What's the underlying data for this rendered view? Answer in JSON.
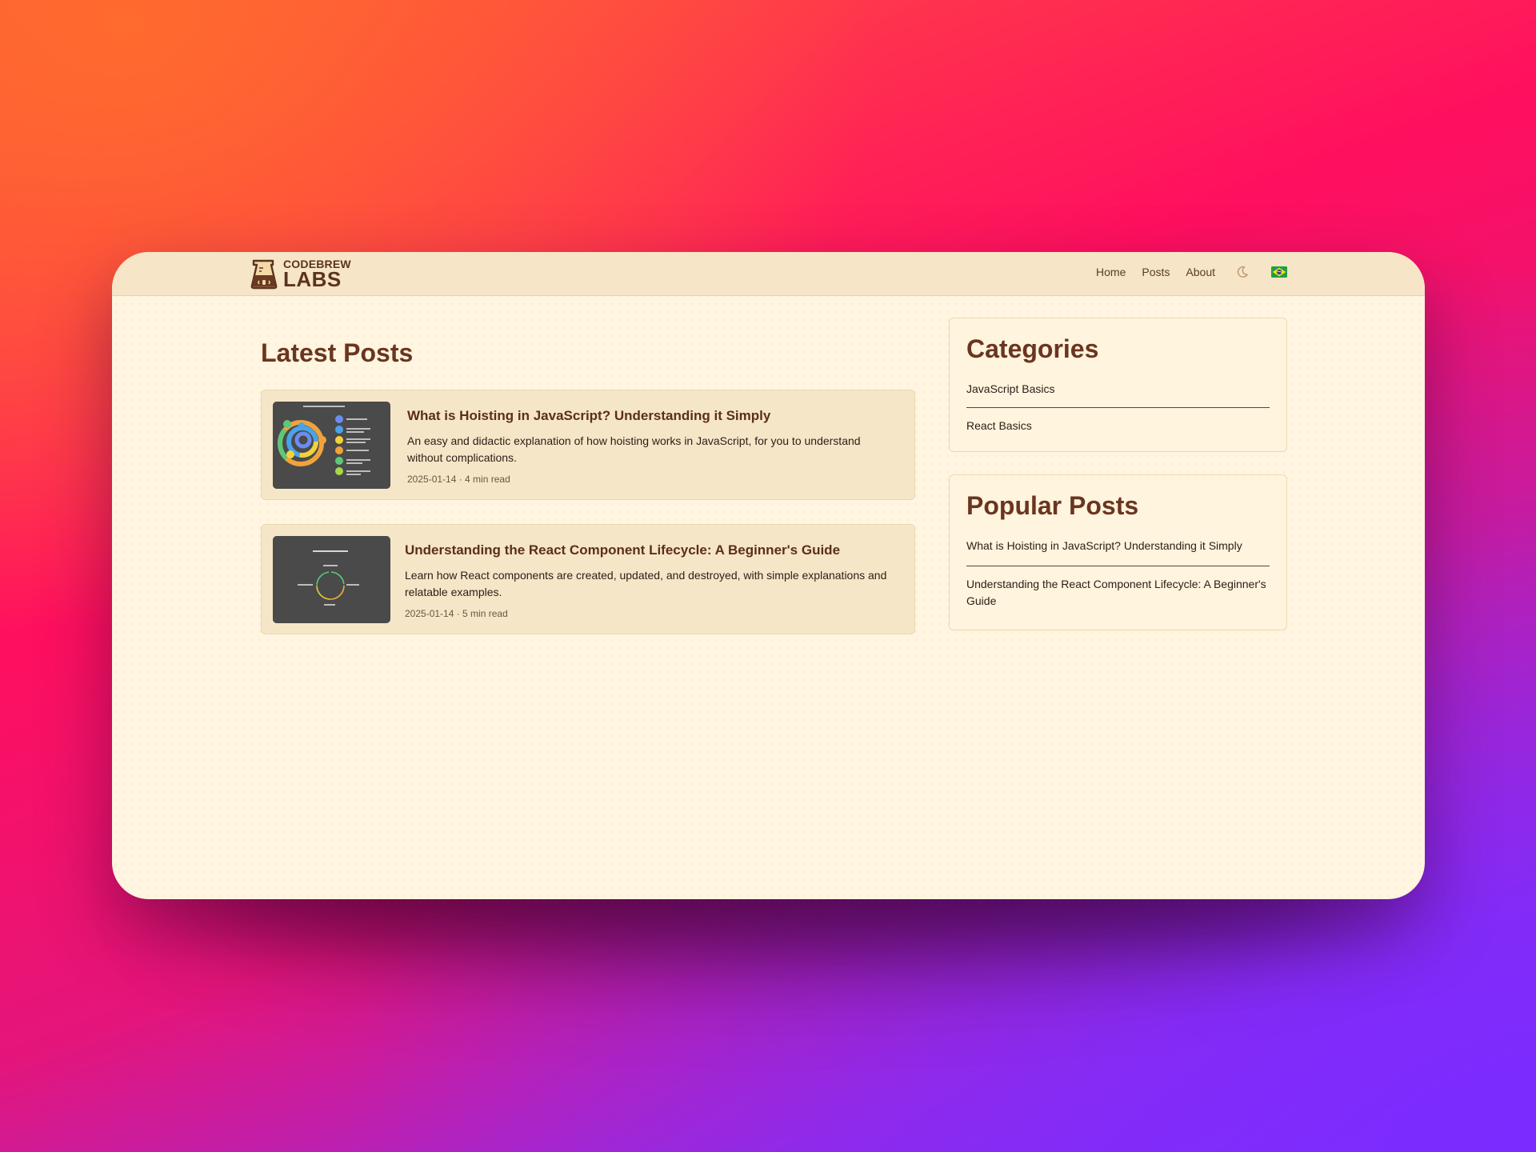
{
  "brand": {
    "line1": "CODEBREW",
    "line2": "LABS"
  },
  "nav": {
    "links": [
      "Home",
      "Posts",
      "About"
    ],
    "theme_icon": "moon-icon",
    "language_icon": "brazil-flag-icon"
  },
  "main": {
    "heading": "Latest Posts",
    "posts": [
      {
        "title": "What is Hoisting in JavaScript? Understanding it Simply",
        "description": "An easy and didactic explanation of how hoisting works in JavaScript, for you to understand without complications.",
        "meta": "2025-01-14 · 4 min read"
      },
      {
        "title": "Understanding the React Component Lifecycle: A Beginner's Guide",
        "description": "Learn how React components are created, updated, and destroyed, with simple explanations and relatable examples.",
        "meta": "2025-01-14 · 5 min read"
      }
    ]
  },
  "sidebar": {
    "categories": {
      "title": "Categories",
      "items": [
        "JavaScript Basics",
        "React Basics"
      ]
    },
    "popular": {
      "title": "Popular Posts",
      "items": [
        "What is Hoisting in JavaScript? Understanding it Simply",
        "Understanding the React Component Lifecycle: A Beginner's Guide"
      ]
    }
  },
  "colors": {
    "accent": "#6a3520",
    "navbar_bg": "#f6e5c6",
    "page_bg": "#fff5e0",
    "card_bg": "#f5e6c8"
  }
}
